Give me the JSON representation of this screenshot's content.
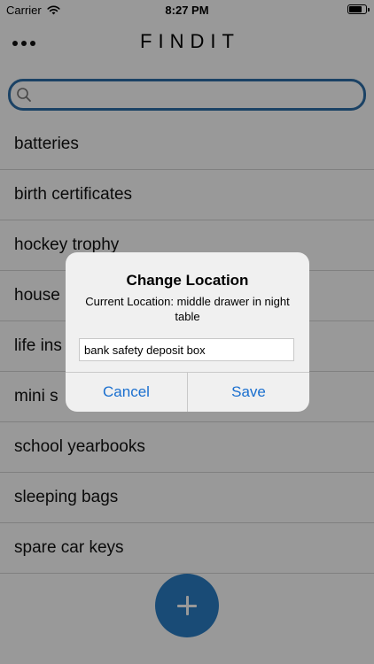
{
  "status_bar": {
    "carrier": "Carrier",
    "time": "8:27 PM",
    "wifi_icon": "wifi-icon",
    "battery_icon": "battery-icon"
  },
  "header": {
    "title": "FINDIT",
    "menu_icon": "more-dots-icon"
  },
  "search": {
    "icon": "search-icon",
    "value": "",
    "placeholder": ""
  },
  "items": [
    "batteries",
    "birth certificates",
    "hockey trophy",
    "house",
    "life ins",
    "mini s",
    "school yearbooks",
    "sleeping bags",
    "spare car keys"
  ],
  "fab": {
    "icon": "plus-icon"
  },
  "dialog": {
    "title": "Change Location",
    "message": "Current Location: middle drawer in night table",
    "input_value": "bank safety deposit box",
    "cancel_label": "Cancel",
    "save_label": "Save"
  },
  "colors": {
    "accent": "#2a7ec5",
    "search_border": "#2d6fa8",
    "dialog_button_text": "#1a6fcf"
  }
}
